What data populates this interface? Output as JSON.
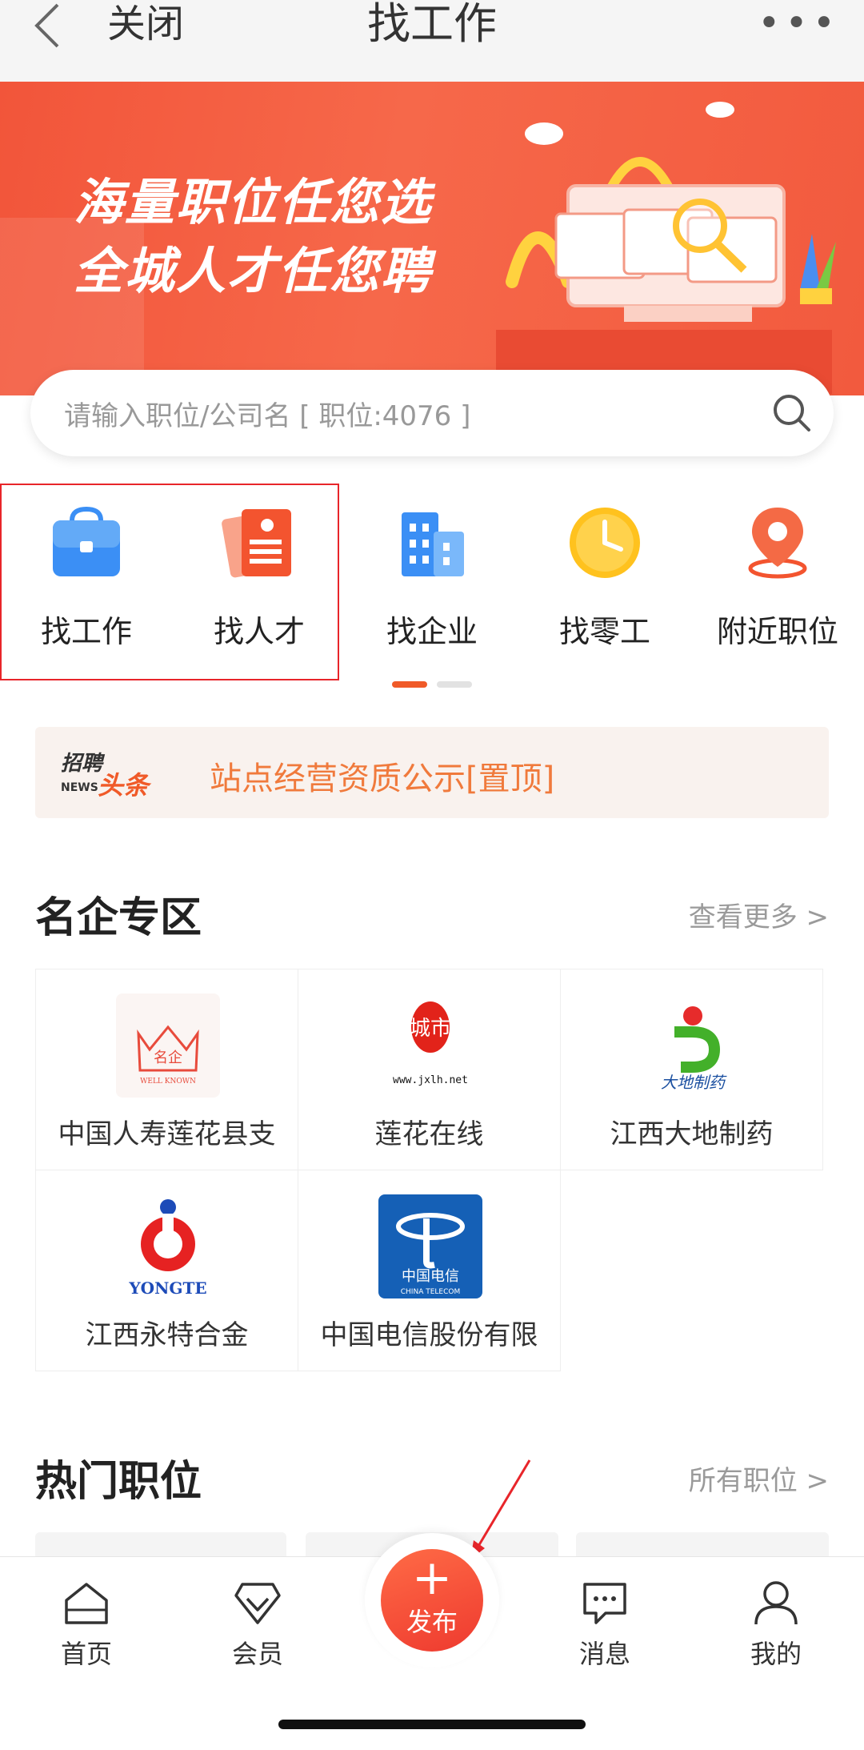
{
  "nav": {
    "close_label": "关闭",
    "title": "找工作",
    "more_label": "•••"
  },
  "banner": {
    "line1": "海量职位任您选",
    "line2": "全城人才任您聘"
  },
  "search": {
    "placeholder": "请输入职位/公司名  [ 职位:4076 ]"
  },
  "categories": [
    {
      "label": "找工作",
      "icon": "briefcase-icon"
    },
    {
      "label": "找人才",
      "icon": "resume-icon"
    },
    {
      "label": "找企业",
      "icon": "building-icon"
    },
    {
      "label": "找零工",
      "icon": "clock-icon"
    },
    {
      "label": "附近职位",
      "icon": "location-pin-icon"
    }
  ],
  "news": {
    "logo_text_top": "招聘",
    "logo_text_en": "NEWS",
    "logo_text_bottom": "头条",
    "headline": "站点经营资质公示[置顶]"
  },
  "famous": {
    "title": "名企专区",
    "more": "查看更多 >",
    "companies": [
      {
        "name": "中国人寿莲花县支",
        "logo_text": "名企",
        "logo_sub": "WELL KNOWN"
      },
      {
        "name": "莲花在线",
        "logo_text": "城市",
        "logo_sub": "www.jxlh.net"
      },
      {
        "name": "江西大地制药",
        "logo_text": "大地制药"
      },
      {
        "name": "江西永特合金",
        "logo_text": "YONGTE"
      },
      {
        "name": "中国电信股份有限",
        "logo_text": "中国电信",
        "logo_sub": "CHINA TELECOM"
      }
    ]
  },
  "hot": {
    "title": "热门职位",
    "more": "所有职位 >"
  },
  "tabbar": {
    "home": "首页",
    "member": "会员",
    "publish": "发布",
    "messages": "消息",
    "mine": "我的"
  },
  "colors": {
    "accent": "#f05a28",
    "banner": "#f25a3e",
    "highlight": "#e8252a"
  }
}
